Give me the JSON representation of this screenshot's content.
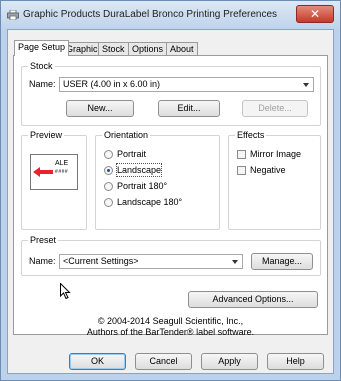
{
  "window": {
    "title": "Graphic Products DuraLabel Bronco Printing Preferences",
    "close_glyph": "✕"
  },
  "tabs": [
    {
      "label": "Page Setup",
      "active": true
    },
    {
      "label": "Graphics",
      "active": false
    },
    {
      "label": "Stock",
      "active": false
    },
    {
      "label": "Options",
      "active": false
    },
    {
      "label": "About",
      "active": false
    }
  ],
  "stock": {
    "group_label": "Stock",
    "name_label": "Name:",
    "name_value": "USER (4.00 in x 6.00 in)",
    "new_button": "New...",
    "edit_button": "Edit...",
    "delete_button": "Delete..."
  },
  "preview": {
    "group_label": "Preview",
    "label_title": "ALE",
    "label_sub": "####"
  },
  "orientation": {
    "group_label": "Orientation",
    "options": [
      {
        "label": "Portrait",
        "checked": false
      },
      {
        "label": "Landscape",
        "checked": true
      },
      {
        "label": "Portrait 180°",
        "checked": false
      },
      {
        "label": "Landscape 180°",
        "checked": false
      }
    ]
  },
  "effects": {
    "group_label": "Effects",
    "options": [
      {
        "label": "Mirror Image",
        "checked": false
      },
      {
        "label": "Negative",
        "checked": false
      }
    ]
  },
  "preset": {
    "group_label": "Preset",
    "name_label": "Name:",
    "name_value": "<Current Settings>",
    "manage_button": "Manage..."
  },
  "advanced_button": "Advanced Options...",
  "copyright": {
    "line1": "© 2004-2014 Seagull Scientific, Inc.,",
    "line2": "Authors of the BarTender® label software."
  },
  "footer": {
    "ok": "OK",
    "cancel": "Cancel",
    "apply": "Apply",
    "help": "Help"
  },
  "colors": {
    "frame": "#bcd2ea",
    "close": "#c43b2a",
    "arrow": "#e8232b"
  }
}
